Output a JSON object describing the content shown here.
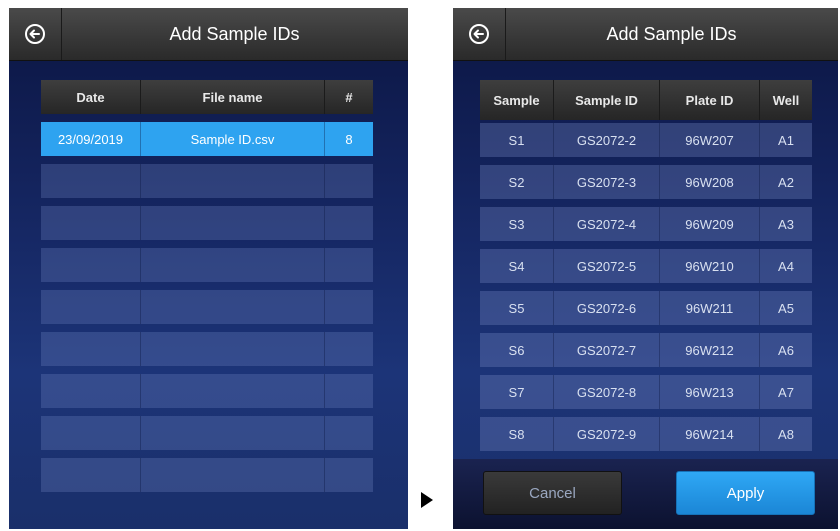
{
  "left": {
    "title": "Add Sample IDs",
    "headers": {
      "date": "Date",
      "file": "File name",
      "count": "#"
    },
    "rows": [
      {
        "date": "23/09/2019",
        "file": "Sample ID.csv",
        "count": "8"
      }
    ]
  },
  "right": {
    "title": "Add Sample IDs",
    "headers": {
      "sample": "Sample",
      "sample_id": "Sample ID",
      "plate_id": "Plate ID",
      "well": "Well"
    },
    "rows": [
      {
        "sample": "S1",
        "sample_id": "GS2072-2",
        "plate_id": "96W207",
        "well": "A1"
      },
      {
        "sample": "S2",
        "sample_id": "GS2072-3",
        "plate_id": "96W208",
        "well": "A2"
      },
      {
        "sample": "S3",
        "sample_id": "GS2072-4",
        "plate_id": "96W209",
        "well": "A3"
      },
      {
        "sample": "S4",
        "sample_id": "GS2072-5",
        "plate_id": "96W210",
        "well": "A4"
      },
      {
        "sample": "S5",
        "sample_id": "GS2072-6",
        "plate_id": "96W211",
        "well": "A5"
      },
      {
        "sample": "S6",
        "sample_id": "GS2072-7",
        "plate_id": "96W212",
        "well": "A6"
      },
      {
        "sample": "S7",
        "sample_id": "GS2072-8",
        "plate_id": "96W213",
        "well": "A7"
      },
      {
        "sample": "S8",
        "sample_id": "GS2072-9",
        "plate_id": "96W214",
        "well": "A8"
      }
    ],
    "buttons": {
      "cancel": "Cancel",
      "apply": "Apply"
    }
  },
  "icons": {
    "back": "back-arrow-circle-icon",
    "transition": "play-arrow-icon"
  },
  "colors": {
    "accent": "#2ea3f0",
    "title_bar": "#333333",
    "background": "#14245e"
  }
}
